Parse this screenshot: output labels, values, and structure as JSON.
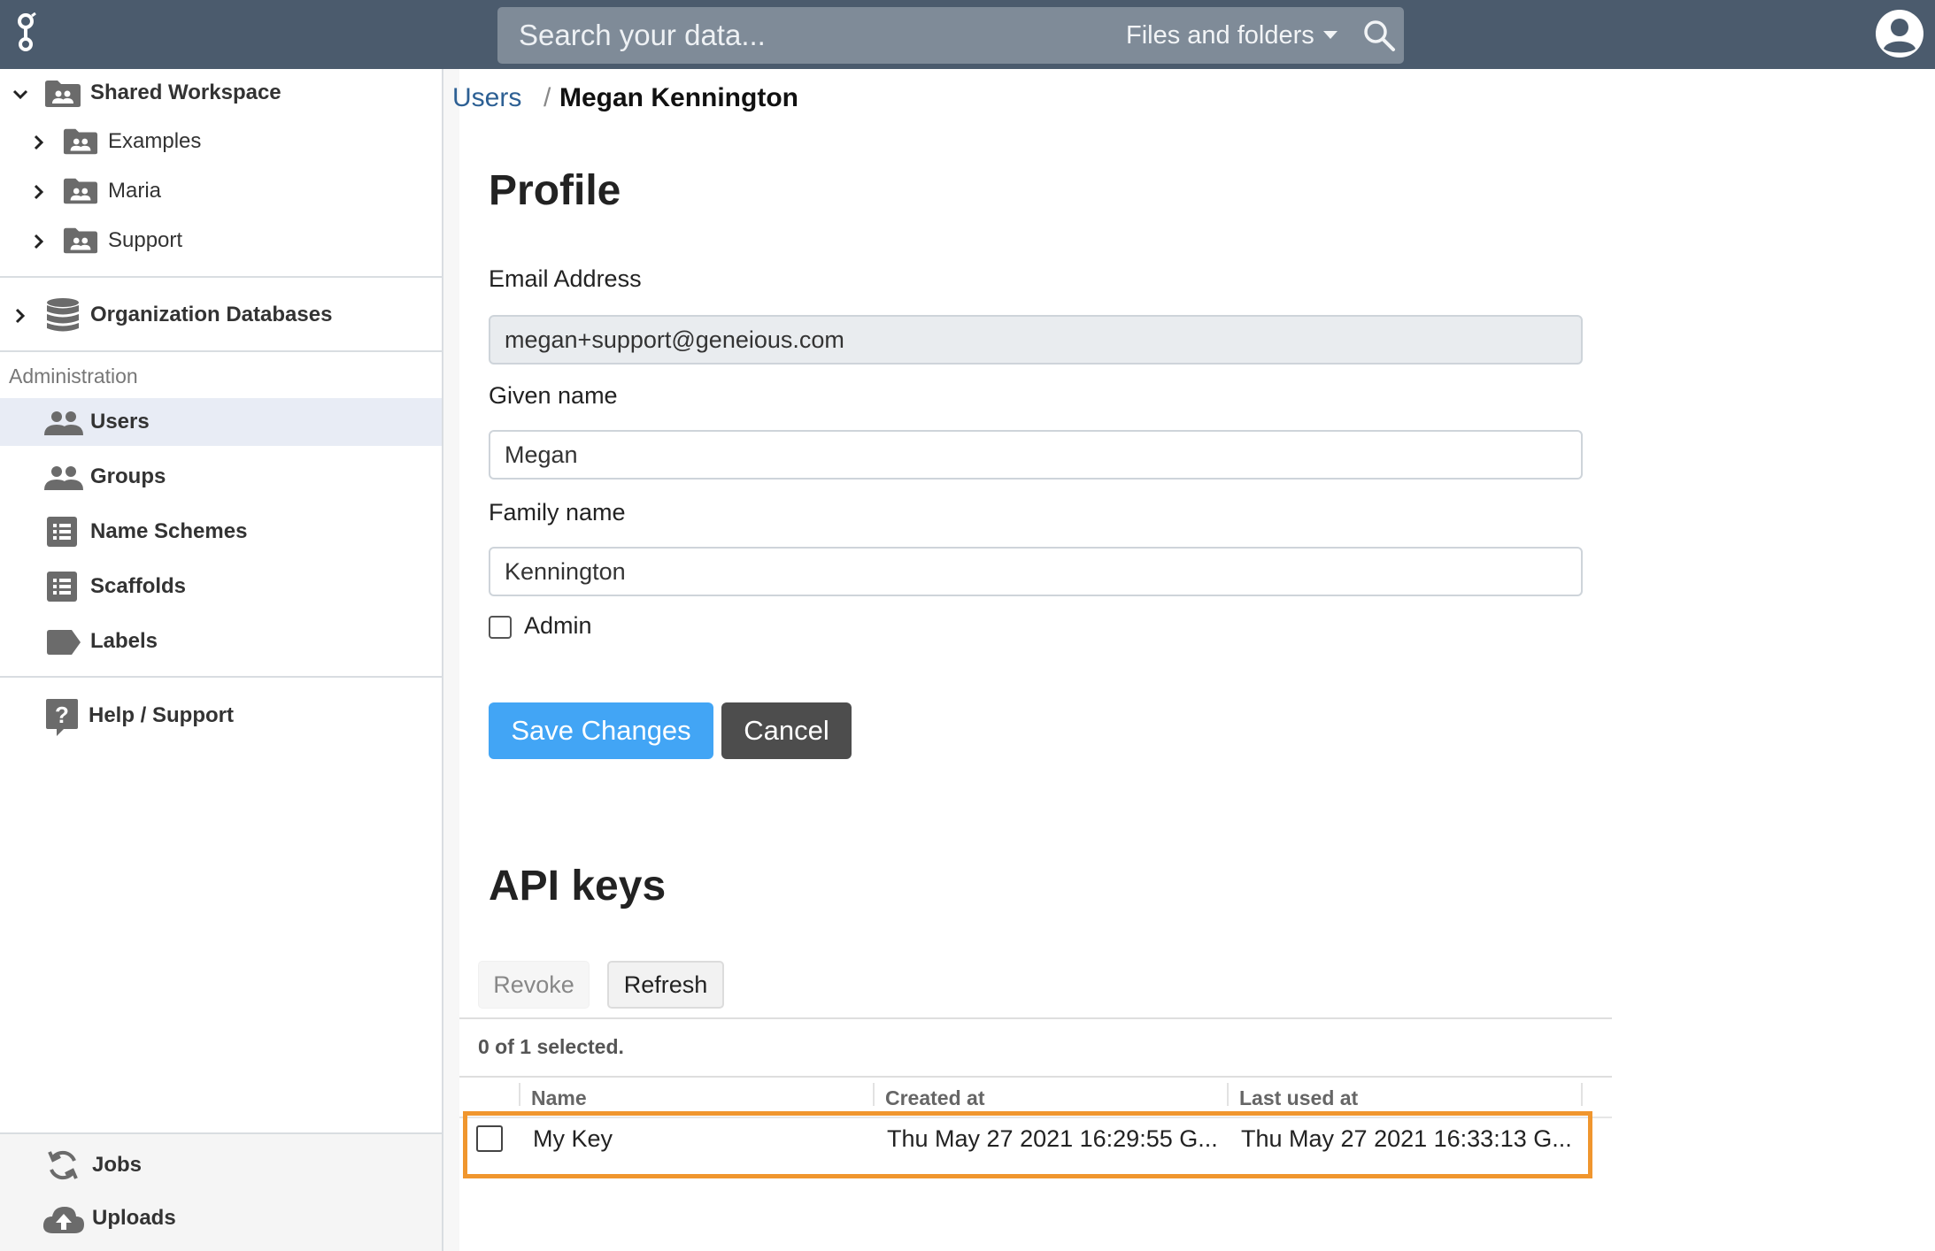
{
  "topbar": {
    "search_placeholder": "Search your data...",
    "search_scope": "Files and folders"
  },
  "sidebar": {
    "workspace": {
      "label": "Shared Workspace",
      "children": [
        "Examples",
        "Maria",
        "Support"
      ]
    },
    "org_databases": "Organization Databases",
    "admin_heading": "Administration",
    "admin_items": [
      "Users",
      "Groups",
      "Name Schemes",
      "Scaffolds",
      "Labels"
    ],
    "help": "Help / Support",
    "bottom_items": [
      "Jobs",
      "Uploads"
    ]
  },
  "breadcrumb": {
    "parent": "Users",
    "separator": "/",
    "current": "Megan Kennington"
  },
  "profile": {
    "heading": "Profile",
    "email_label": "Email Address",
    "email_value": "megan+support@geneious.com",
    "given_label": "Given name",
    "given_value": "Megan",
    "family_label": "Family name",
    "family_value": "Kennington",
    "admin_label": "Admin",
    "save_label": "Save Changes",
    "cancel_label": "Cancel"
  },
  "api_keys": {
    "heading": "API keys",
    "revoke_label": "Revoke",
    "refresh_label": "Refresh",
    "selected_text": "0 of 1 selected.",
    "columns": [
      "Name",
      "Created at",
      "Last used at"
    ],
    "rows": [
      {
        "name": "My Key",
        "created": "Thu May 27 2021 16:29:55 G...",
        "last_used": "Thu May 27 2021 16:33:13 G..."
      }
    ]
  },
  "colors": {
    "topbar": "#4b5b6d",
    "primary": "#42a5f5",
    "highlight": "#f0962e",
    "link": "#2d6094"
  }
}
